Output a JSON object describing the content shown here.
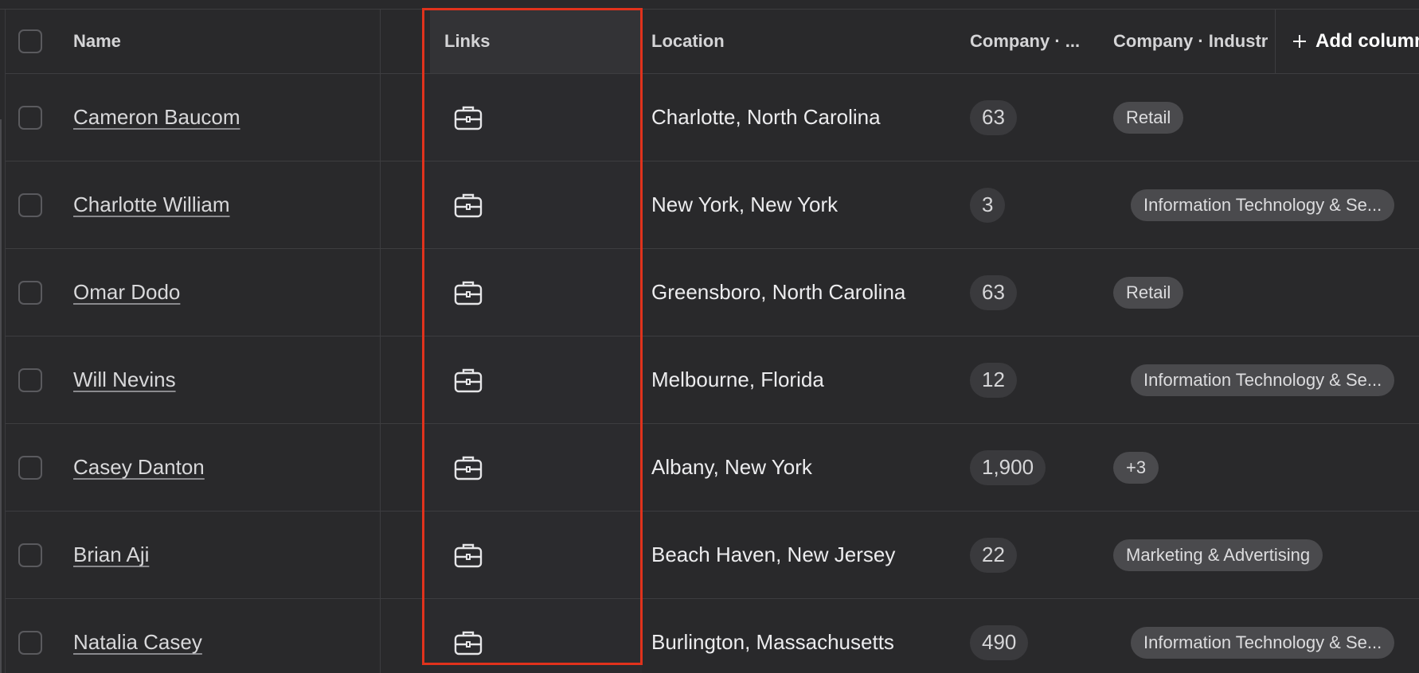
{
  "header": {
    "name": "Name",
    "links": "Links",
    "location": "Location",
    "company_size": "Company · ...",
    "company_industry": "Company · Industr",
    "add_column": "Add column"
  },
  "rows": [
    {
      "name": "Cameron Baucom",
      "location": "Charlotte, North Carolina",
      "employees": "63",
      "industry": "Retail"
    },
    {
      "name": "Charlotte William",
      "location": "New York, New York",
      "employees": "3",
      "industry": "Information Technology & Se..."
    },
    {
      "name": "Omar Dodo",
      "location": "Greensboro, North Carolina",
      "employees": "63",
      "industry": "Retail"
    },
    {
      "name": "Will Nevins",
      "location": "Melbourne, Florida",
      "employees": "12",
      "industry": "Information Technology & Se..."
    },
    {
      "name": "Casey Danton",
      "location": "Albany, New York",
      "employees": "1,900",
      "industry": "+3"
    },
    {
      "name": "Brian Aji",
      "location": "Beach Haven, New Jersey",
      "employees": "22",
      "industry": "Marketing & Advertising"
    },
    {
      "name": "Natalia Casey",
      "location": "Burlington, Massachusetts",
      "employees": "490",
      "industry": "Information Technology & Se..."
    }
  ],
  "icons": {
    "link_icon": "briefcase-icon",
    "add_icon": "plus-icon"
  },
  "colors": {
    "background": "#29292b",
    "highlight": "#e0321c"
  }
}
